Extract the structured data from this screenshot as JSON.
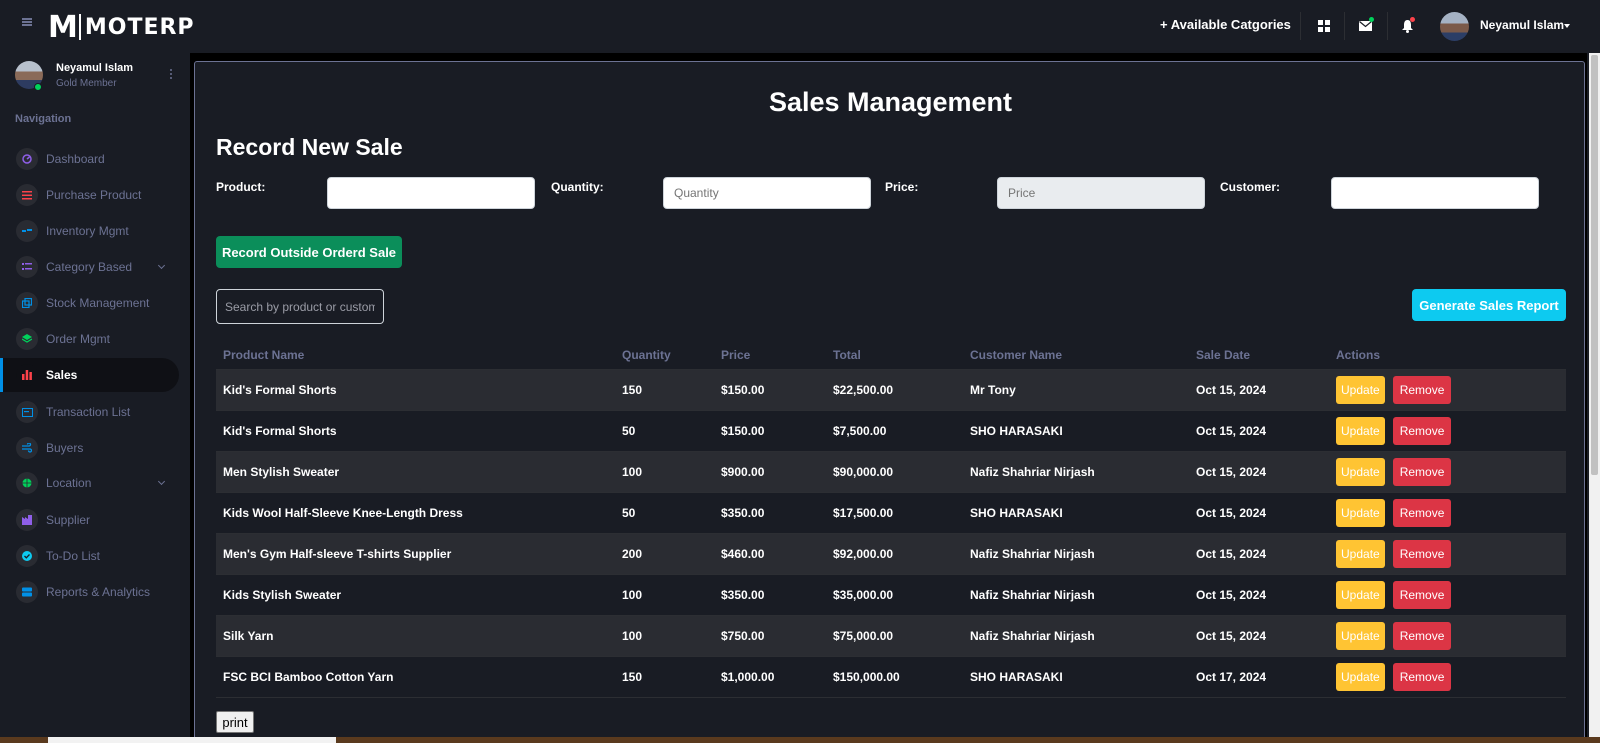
{
  "brand": {
    "logo_mark": "M",
    "logo_text": "MOTERP"
  },
  "topbar": {
    "categories_link": "+ Available Catgories",
    "user_name": "Neyamul Islam",
    "icons": [
      "grid-icon",
      "envelope-icon",
      "bell-icon"
    ]
  },
  "sidebar": {
    "profile": {
      "name": "Neyamul Islam",
      "role": "Gold Member"
    },
    "heading": "Navigation",
    "items": [
      {
        "label": "Dashboard",
        "icon": "speedometer-icon",
        "color": "#8f5fe8"
      },
      {
        "label": "Purchase Product",
        "icon": "list-icon",
        "color": "#fc424a"
      },
      {
        "label": "Inventory Mgmt",
        "icon": "dashes-icon",
        "color": "#0090e7"
      },
      {
        "label": "Category Based",
        "icon": "checklist-icon",
        "color": "#8f5fe8",
        "expandable": true
      },
      {
        "label": "Stock Management",
        "icon": "copy-icon",
        "color": "#0090e7"
      },
      {
        "label": "Order Mgmt",
        "icon": "layers-icon",
        "color": "#00d25b"
      },
      {
        "label": "Sales",
        "icon": "bar-chart-icon",
        "color": "#fc424a",
        "active": true
      },
      {
        "label": "Transaction List",
        "icon": "card-icon",
        "color": "#0090e7"
      },
      {
        "label": "Buyers",
        "icon": "wind-icon",
        "color": "#0090e7"
      },
      {
        "label": "Location",
        "icon": "globe-icon",
        "color": "#00d25b",
        "expandable": true
      },
      {
        "label": "Supplier",
        "icon": "factory-icon",
        "color": "#8f5fe8"
      },
      {
        "label": "To-Do List",
        "icon": "check-circle-icon",
        "color": "#0dcaf0"
      },
      {
        "label": "Reports & Analytics",
        "icon": "server-icon",
        "color": "#0090e7"
      }
    ]
  },
  "main": {
    "title": "Sales Management",
    "section_title": "Record New Sale",
    "form": {
      "product_label": "Product:",
      "product_value": "",
      "quantity_label": "Quantity:",
      "quantity_placeholder": "Quantity",
      "price_label": "Price:",
      "price_placeholder": "Price",
      "customer_label": "Customer:",
      "customer_value": ""
    },
    "record_button": "Record Outside Orderd Sale",
    "search_placeholder": "Search by product or customer",
    "report_button": "Generate Sales Report",
    "table": {
      "headers": [
        "Product Name",
        "Quantity",
        "Price",
        "Total",
        "Customer Name",
        "Sale Date",
        "Actions"
      ],
      "update_label": "Update",
      "remove_label": "Remove",
      "rows": [
        {
          "product": "Kid's Formal Shorts",
          "quantity": "150",
          "price": "$150.00",
          "total": "$22,500.00",
          "customer": "Mr Tony",
          "date": "Oct 15, 2024"
        },
        {
          "product": "Kid's Formal Shorts",
          "quantity": "50",
          "price": "$150.00",
          "total": "$7,500.00",
          "customer": "SHO HARASAKI",
          "date": "Oct 15, 2024"
        },
        {
          "product": "Men Stylish Sweater",
          "quantity": "100",
          "price": "$900.00",
          "total": "$90,000.00",
          "customer": "Nafiz Shahriar Nirjash",
          "date": "Oct 15, 2024"
        },
        {
          "product": "Kids Wool Half-Sleeve Knee-Length Dress",
          "quantity": "50",
          "price": "$350.00",
          "total": "$17,500.00",
          "customer": "SHO HARASAKI",
          "date": "Oct 15, 2024"
        },
        {
          "product": "Men's Gym Half-sleeve T-shirts Supplier",
          "quantity": "200",
          "price": "$460.00",
          "total": "$92,000.00",
          "customer": "Nafiz Shahriar Nirjash",
          "date": "Oct 15, 2024"
        },
        {
          "product": "Kids Stylish Sweater",
          "quantity": "100",
          "price": "$350.00",
          "total": "$35,000.00",
          "customer": "Nafiz Shahriar Nirjash",
          "date": "Oct 15, 2024"
        },
        {
          "product": "Silk Yarn",
          "quantity": "100",
          "price": "$750.00",
          "total": "$75,000.00",
          "customer": "Nafiz Shahriar Nirjash",
          "date": "Oct 15, 2024"
        },
        {
          "product": "FSC BCI Bamboo Cotton Yarn",
          "quantity": "150",
          "price": "$1,000.00",
          "total": "$150,000.00",
          "customer": "SHO HARASAKI",
          "date": "Oct 17, 2024"
        }
      ]
    },
    "print_button": "print"
  }
}
